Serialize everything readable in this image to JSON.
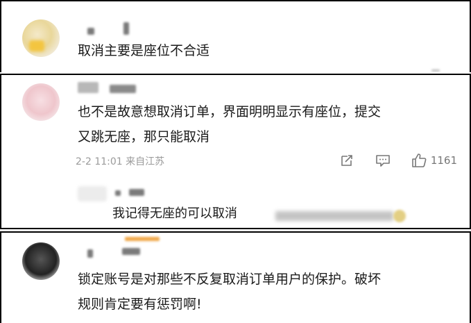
{
  "comments": [
    {
      "text": "取消主要是座位不合适"
    },
    {
      "text_lines": [
        "也不是故意想取消订单，界面明明显示有座位，提交",
        "又跳无座，那只能取消"
      ],
      "meta": "2-2 11:01 来自江苏",
      "like_count": "1161",
      "reply": {
        "text": "我记得无座的可以取消"
      }
    },
    {
      "text_lines": [
        "锁定账号是对那些不反复取消订单用户的保护。破坏",
        "规则肯定要有惩罚啊!"
      ]
    }
  ],
  "icons": [
    "share-icon",
    "comment-icon",
    "like-icon"
  ],
  "colors": {
    "text": "#1a1a1a",
    "meta": "#9a9a9a",
    "border": "#000000",
    "icon": "#777777"
  }
}
